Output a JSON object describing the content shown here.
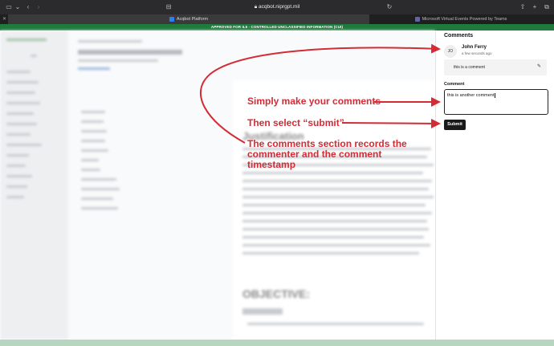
{
  "browser": {
    "url": "acqbot.niprgpt.mil",
    "tabs": [
      {
        "label": "Acqbot Platform"
      },
      {
        "label": "Microsoft Virtual Events Powered by Teams"
      }
    ]
  },
  "banner": {
    "text": "APPROVED FOR IL5 - CONTROLLED UNCLASSIFIED INFORMATION (CUI)"
  },
  "background_document": {
    "heading_1": "Justification",
    "heading_2": "OBJECTIVE:"
  },
  "comments_panel": {
    "title": "Comments",
    "comments": [
      {
        "initials": "JO",
        "author": "John Ferry",
        "timestamp": "a few seconds ago",
        "text": "this is a comment"
      }
    ],
    "input_label": "Comment",
    "input_value": "this is another comment",
    "submit_label": "Submit"
  },
  "annotations": [
    {
      "text": "Simply make your comments"
    },
    {
      "text": "Then select “submit”"
    },
    {
      "text": "The comments section records the commenter and the comment timestamp"
    }
  ],
  "colors": {
    "annotation": "#d42b35",
    "banner": "#1f7a3b",
    "submit": "#1a1a1a"
  }
}
